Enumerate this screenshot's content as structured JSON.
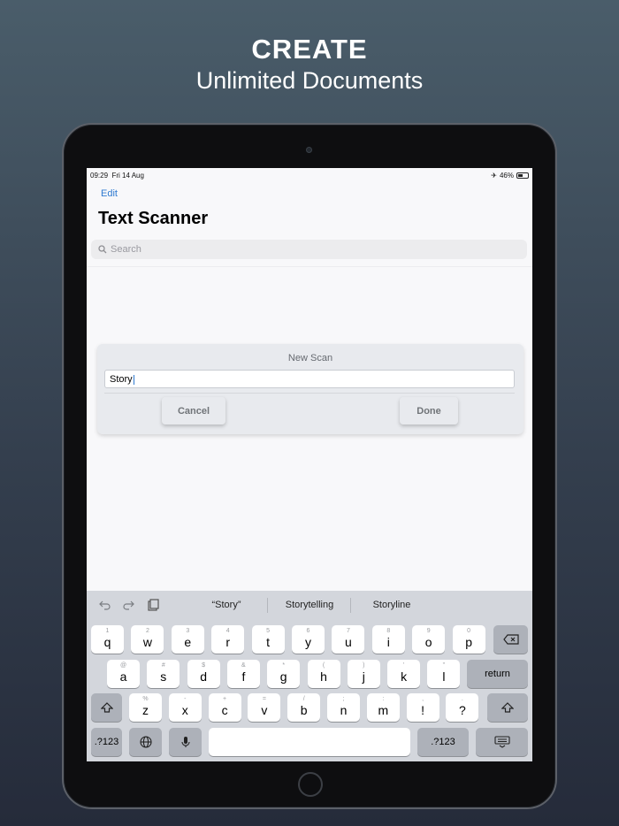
{
  "headline": {
    "title": "CREATE",
    "subtitle": "Unlimited Documents"
  },
  "status_bar": {
    "time": "09:29",
    "date": "Fri 14 Aug",
    "battery": "46%"
  },
  "nav": {
    "edit_label": "Edit",
    "title": "Text Scanner"
  },
  "search": {
    "placeholder": "Search"
  },
  "dialog": {
    "title": "New Scan",
    "input_value": "Story",
    "cancel_label": "Cancel",
    "done_label": "Done"
  },
  "keyboard": {
    "suggestions": [
      "“Story”",
      "Storytelling",
      "Storyline"
    ],
    "row1": [
      {
        "k": "q",
        "s": "1"
      },
      {
        "k": "w",
        "s": "2"
      },
      {
        "k": "e",
        "s": "3"
      },
      {
        "k": "r",
        "s": "4"
      },
      {
        "k": "t",
        "s": "5"
      },
      {
        "k": "y",
        "s": "6"
      },
      {
        "k": "u",
        "s": "7"
      },
      {
        "k": "i",
        "s": "8"
      },
      {
        "k": "o",
        "s": "9"
      },
      {
        "k": "p",
        "s": "0"
      }
    ],
    "row2": [
      {
        "k": "a",
        "s": "@"
      },
      {
        "k": "s",
        "s": "#"
      },
      {
        "k": "d",
        "s": "$"
      },
      {
        "k": "f",
        "s": "&"
      },
      {
        "k": "g",
        "s": "*"
      },
      {
        "k": "h",
        "s": "("
      },
      {
        "k": "j",
        "s": ")"
      },
      {
        "k": "k",
        "s": "'"
      },
      {
        "k": "l",
        "s": "\""
      }
    ],
    "row3": [
      {
        "k": "z",
        "s": "%"
      },
      {
        "k": "x",
        "s": "-"
      },
      {
        "k": "c",
        "s": "+"
      },
      {
        "k": "v",
        "s": "="
      },
      {
        "k": "b",
        "s": "/"
      },
      {
        "k": "n",
        "s": ";"
      },
      {
        "k": "m",
        "s": ":"
      },
      {
        "k": "!",
        "s": ","
      },
      {
        "k": "?",
        "s": "."
      }
    ],
    "return_label": "return",
    "numbers_label": ".?123"
  }
}
